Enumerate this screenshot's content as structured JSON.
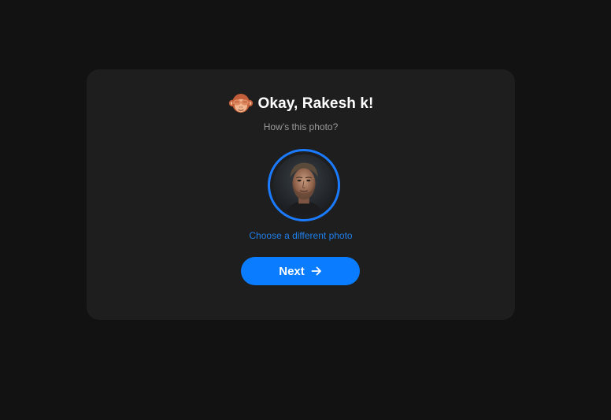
{
  "card": {
    "emoji_icon": "see-no-evil-monkey-icon",
    "title": "Okay, Rakesh k!",
    "subtitle": "How’s this photo?",
    "photo_alt": "Profile photo",
    "choose_link": "Choose a different photo",
    "next_label": "Next",
    "next_icon": "arrow-right-icon"
  },
  "colors": {
    "background": "#121212",
    "card": "#1e1e1e",
    "accent": "#0a7cff",
    "ring": "#1b7bff",
    "link": "#1f7ee8",
    "subtitle": "#9a9a9a",
    "title": "#ffffff"
  }
}
